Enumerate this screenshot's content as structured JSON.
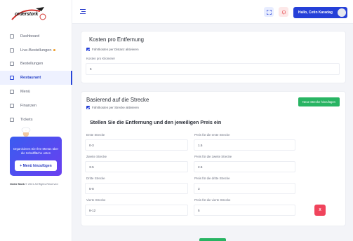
{
  "logo": {
    "text": "orderstork"
  },
  "sidebar": {
    "items": [
      {
        "label": "Dashboard",
        "icon": "dashboard-icon",
        "active": false
      },
      {
        "label": "Live-Bestellungen",
        "icon": "live-orders-icon",
        "active": false,
        "dot": true
      },
      {
        "label": "Bestellungen",
        "icon": "orders-icon",
        "active": false
      },
      {
        "label": "Restaurant",
        "icon": "restaurant-icon",
        "active": true
      },
      {
        "label": "Menü",
        "icon": "menu-icon",
        "active": false
      },
      {
        "label": "Finanzen",
        "icon": "finance-icon",
        "active": false
      },
      {
        "label": "Tickets",
        "icon": "tickets-icon",
        "active": false
      }
    ],
    "promo": {
      "text": "Organisieren Sie Ihre Menüs über die Schaltfläche unten",
      "button": "+ Menü hinzufügen"
    },
    "footer_brand": "Order Stork",
    "footer_text": "© 2021 All Rights Reserved"
  },
  "topbar": {
    "user_label": "Hallo, Cetin Karadag"
  },
  "cost_card": {
    "title": "Kosten pro Entfernung",
    "checkbox_label": "Fahrtkosten per Distanz aktivieren",
    "field_label": "Kosten pro Kilometer",
    "field_value": "5"
  },
  "route_card": {
    "title": "Basierend auf die Strecke",
    "checkbox_label": "Fahrtkosten per Strecke aktivieren",
    "add_button": "Neue Strecke hinzufügen",
    "section_title": "Stellen Sie die Entfernung und den jeweiligen Preis ein",
    "rows": [
      {
        "dist_label": "Erste Strecke",
        "dist_value": "0-3",
        "price_label": "Preis für die erste Strecke",
        "price_value": "1.5"
      },
      {
        "dist_label": "Zweite Strecke",
        "dist_value": "3-5",
        "price_label": "Preis für die zweite Strecke",
        "price_value": "2.5"
      },
      {
        "dist_label": "Dritte Strecke",
        "dist_value": "5-8",
        "price_label": "Preis für die dritte Strecke",
        "price_value": "3"
      },
      {
        "dist_label": "Vierte Strecke",
        "dist_value": "8-12",
        "price_label": "Preis für die vierte Strecke",
        "price_value": "5"
      }
    ],
    "delete_label": "X"
  },
  "colors": {
    "primary": "#2540d8",
    "success": "#28b463",
    "danger": "#f0445c"
  }
}
